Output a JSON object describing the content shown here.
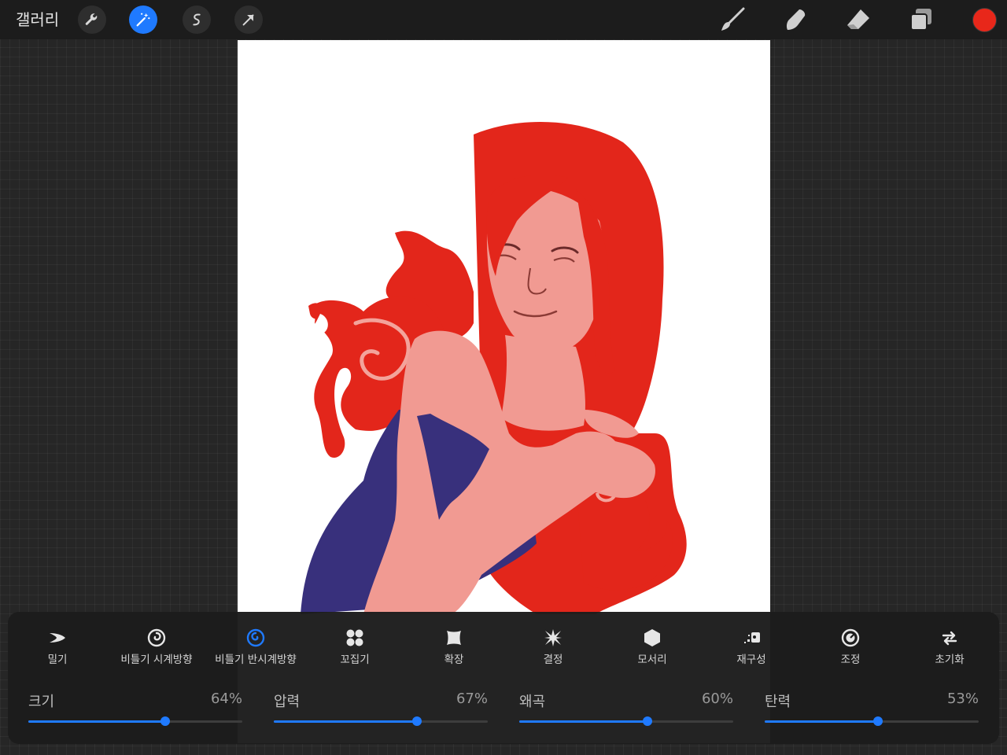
{
  "topbar": {
    "gallery_label": "갤러리",
    "left_tools": [
      {
        "name": "wrench-icon",
        "active": false
      },
      {
        "name": "magic-wand-icon",
        "active": true
      },
      {
        "name": "selection-s-icon",
        "active": false
      },
      {
        "name": "arrow-cursor-icon",
        "active": false
      }
    ],
    "right_tools": [
      "brush-icon",
      "smudge-icon",
      "eraser-icon",
      "layers-icon"
    ],
    "current_color": "#e8271a"
  },
  "liquify": {
    "modes": [
      {
        "label": "밀기",
        "icon": "push-icon",
        "active": false
      },
      {
        "label": "비틀기 시계방향",
        "icon": "twirl-right-icon",
        "active": false
      },
      {
        "label": "비틀기 반시계방향",
        "icon": "twirl-left-icon",
        "active": true
      },
      {
        "label": "꼬집기",
        "icon": "pinch-icon",
        "active": false
      },
      {
        "label": "확장",
        "icon": "expand-icon",
        "active": false
      },
      {
        "label": "결정",
        "icon": "crystals-icon",
        "active": false
      },
      {
        "label": "모서리",
        "icon": "edge-icon",
        "active": false
      },
      {
        "label": "재구성",
        "icon": "reconstruct-icon",
        "active": false
      },
      {
        "label": "조정",
        "icon": "adjust-icon",
        "active": false
      },
      {
        "label": "초기화",
        "icon": "reset-icon",
        "active": false
      }
    ],
    "sliders": [
      {
        "label": "크기",
        "value_text": "64%",
        "value": 0.64
      },
      {
        "label": "압력",
        "value_text": "67%",
        "value": 0.67
      },
      {
        "label": "왜곡",
        "value_text": "60%",
        "value": 0.6
      },
      {
        "label": "탄력",
        "value_text": "53%",
        "value": 0.53
      }
    ]
  },
  "colors": {
    "accent": "#1f7aff",
    "hair": "#e3261b",
    "skin": "#f19a92",
    "dress": "#38307c"
  }
}
